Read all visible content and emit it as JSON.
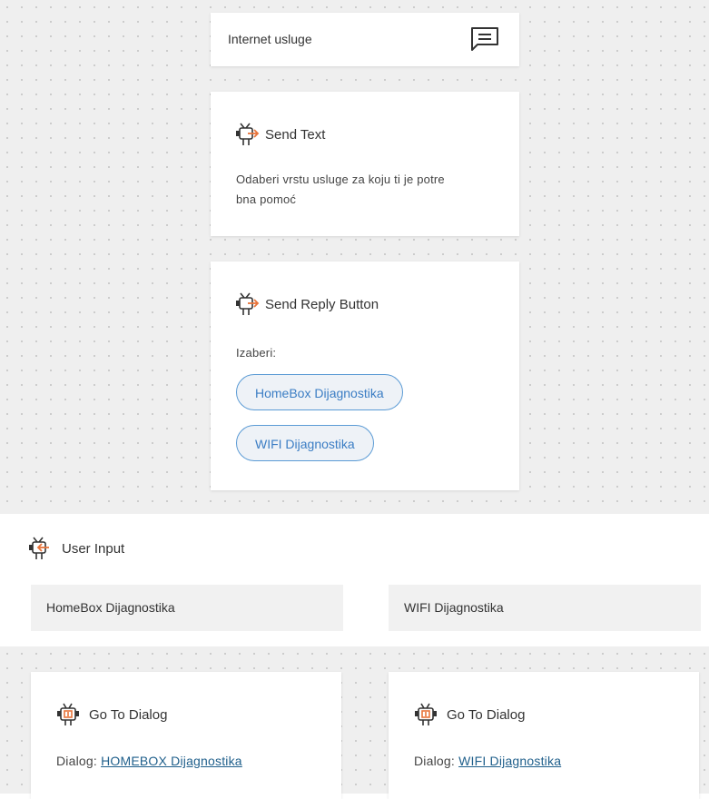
{
  "top_card": {
    "title": "Internet usluge",
    "icon": "chat-icon"
  },
  "send_text": {
    "title": "Send Text",
    "line1": "Odaberi vrstu usluge za koju ti je potre",
    "line2": "bna pomoć"
  },
  "send_reply": {
    "title": "Send Reply Button",
    "prompt": "Izaberi:",
    "buttons": [
      "HomeBox Dijagnostika",
      "WIFI Dijagnostika"
    ]
  },
  "user_input": {
    "title": "User Input",
    "options": [
      "HomeBox Dijagnostika",
      "WIFI Dijagnostika"
    ]
  },
  "goto_left": {
    "title": "Go To Dialog",
    "prefix": "Dialog:",
    "link": "HOMEBOX Dijagnostika"
  },
  "goto_right": {
    "title": "Go To Dialog",
    "prefix": "Dialog:",
    "link": "WIFI Dijagnostika"
  },
  "colors": {
    "accent_orange": "#e8743b",
    "pill_blue": "#5b9bd5",
    "link_blue": "#1f5f8b"
  }
}
